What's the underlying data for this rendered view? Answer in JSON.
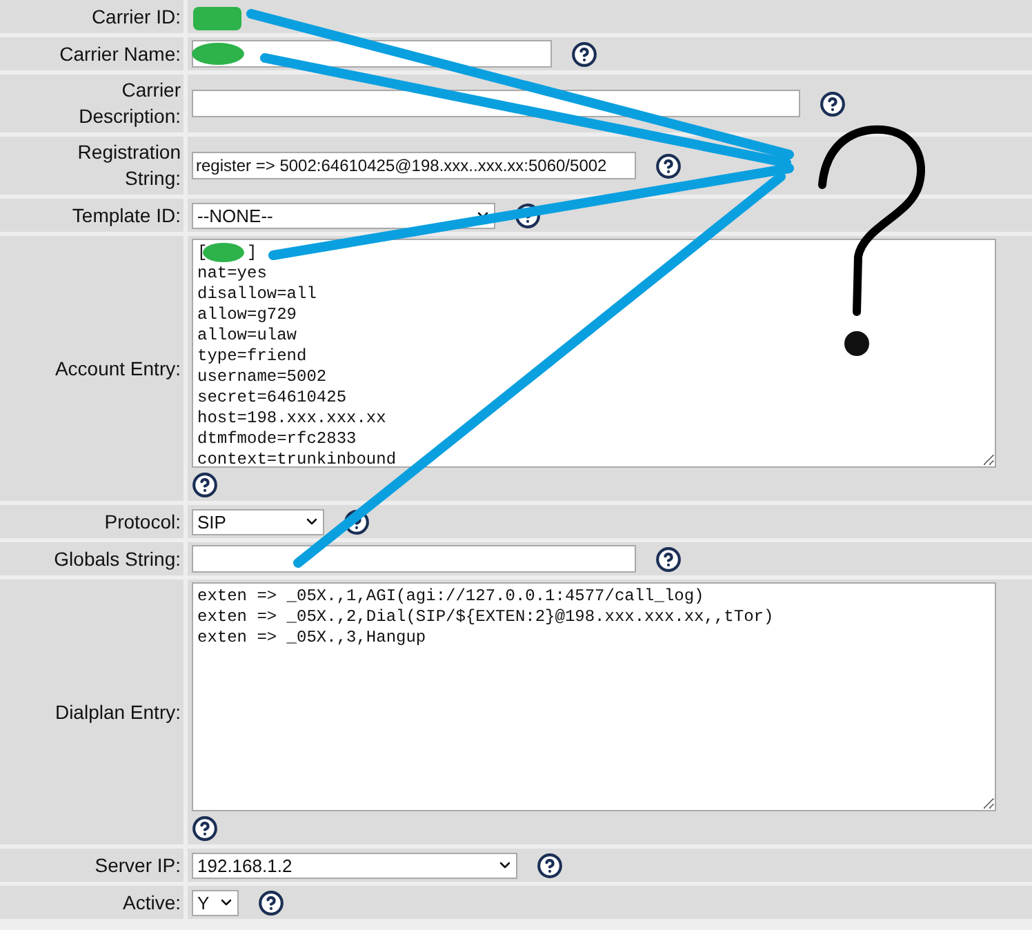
{
  "rows": [
    {
      "label": "Carrier ID:",
      "kind": "static",
      "help": false
    },
    {
      "label": "Carrier Name:",
      "kind": "text",
      "value": "",
      "help": true
    },
    {
      "label": "Carrier Description:",
      "kind": "text",
      "value": "",
      "help": true
    },
    {
      "label": "Registration String:",
      "kind": "text",
      "value": "register => 5002:64610425@198.xxx..xxx.xx:5060/5002",
      "help": true
    },
    {
      "label": "Template ID:",
      "kind": "select",
      "value": "--NONE--",
      "help": true
    },
    {
      "label": "Account Entry:",
      "kind": "textarea",
      "lines": [
        "[    ]",
        "nat=yes",
        "disallow=all",
        "allow=g729",
        "allow=ulaw",
        "type=friend",
        "username=5002",
        "secret=64610425",
        "host=198.xxx.xxx.xx",
        "dtmfmode=rfc2833",
        "context=trunkinbound"
      ],
      "help": true
    },
    {
      "label": "Protocol:",
      "kind": "select",
      "value": "SIP",
      "help": true
    },
    {
      "label": "Globals String:",
      "kind": "text",
      "value": "",
      "help": true
    },
    {
      "label": "Dialplan Entry:",
      "kind": "textarea",
      "lines": [
        "exten => _05X.,1,AGI(agi://127.0.0.1:4577/call_log)",
        "exten => _05X.,2,Dial(SIP/${EXTEN:2}@198.xxx.xxx.xx,,tTor)",
        "exten => _05X.,3,Hangup"
      ],
      "help": true
    },
    {
      "label": "Server IP:",
      "kind": "select",
      "value": "192.168.1.2",
      "help": true
    },
    {
      "label": "Active:",
      "kind": "select",
      "value": "Y",
      "help": true
    }
  ]
}
